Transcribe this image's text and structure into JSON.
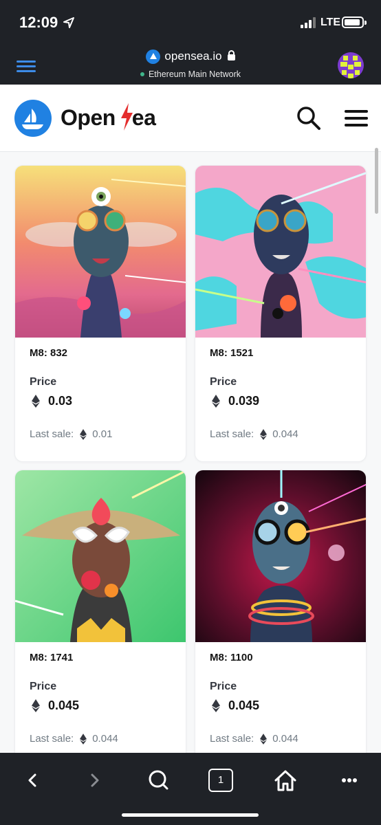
{
  "status_bar": {
    "time": "12:09",
    "network": "LTE"
  },
  "browser": {
    "domain": "opensea.io",
    "network_label": "Ethereum Main Network",
    "tabs_count": "1"
  },
  "header": {
    "brand_prefix": "Open",
    "brand_suffix": "ea"
  },
  "price_label": "Price",
  "last_sale_label": "Last sale:",
  "cards": [
    {
      "name": "M8: 832",
      "price": "0.03",
      "last_sale": "0.01"
    },
    {
      "name": "M8: 1521",
      "price": "0.039",
      "last_sale": "0.044"
    },
    {
      "name": "M8: 1741",
      "price": "0.045",
      "last_sale": "0.044"
    },
    {
      "name": "M8: 1100",
      "price": "0.045",
      "last_sale": "0.044"
    }
  ],
  "colors": {
    "brand_blue": "#2081e2",
    "bolt_red": "#e42d2d",
    "chrome_dark": "#1f2227"
  },
  "icons": [
    "location-arrow-icon",
    "signal-icon",
    "battery-icon",
    "lock-icon",
    "ethereum-icon",
    "search-icon",
    "menu-icon",
    "back-icon",
    "forward-icon",
    "tabs-icon",
    "home-icon",
    "more-icon"
  ]
}
